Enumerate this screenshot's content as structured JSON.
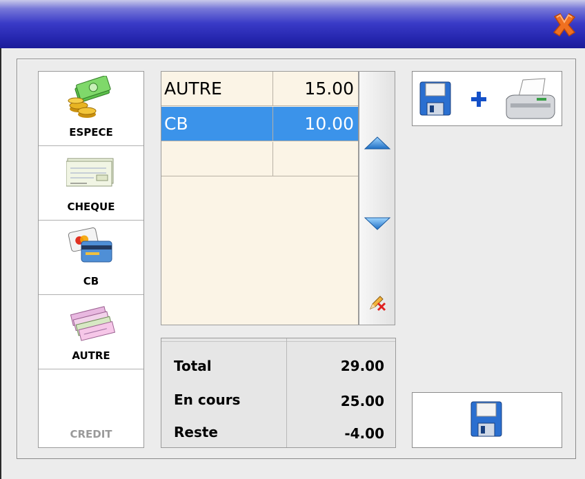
{
  "payment_types": [
    {
      "label": "ESPECE",
      "icon": "cash-coins-icon"
    },
    {
      "label": "CHEQUE",
      "icon": "cheque-icon"
    },
    {
      "label": "CB",
      "icon": "credit-card-icon"
    },
    {
      "label": "AUTRE",
      "icon": "vouchers-icon"
    },
    {
      "label": "CREDIT",
      "icon": "",
      "disabled": true
    }
  ],
  "payments": [
    {
      "name": "AUTRE",
      "amount": "15.00"
    },
    {
      "name": "CB",
      "amount": "10.00",
      "selected": true
    },
    {
      "name": "",
      "amount": ""
    }
  ],
  "totals": {
    "total_label": "Total",
    "total_value": "29.00",
    "encours_label": "En cours",
    "encours_value": "25.00",
    "reste_label": "Reste",
    "reste_value": "-4.00"
  },
  "colors": {
    "selection": "#3b93ea",
    "list_bg": "#fbf4e6",
    "title_bar": "#2627b0"
  }
}
